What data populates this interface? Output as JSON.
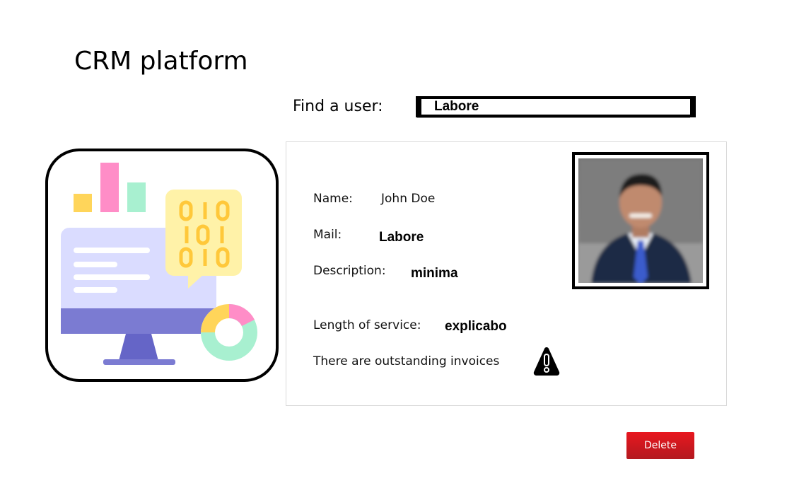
{
  "header": {
    "title": "CRM platform"
  },
  "search": {
    "label": "Find a user:",
    "value": "Labore"
  },
  "user": {
    "name_label": "Name:",
    "name_value": "John Doe",
    "mail_label": "Mail:",
    "mail_value": "Labore",
    "description_label": "Description:",
    "description_value": "minima",
    "service_label": "Length of service:",
    "service_value": "explicabo",
    "invoice_notice": "There are outstanding invoices"
  },
  "actions": {
    "delete_label": "Delete"
  },
  "icons": {
    "warning": "warning-icon",
    "illustration": "crm-dashboard-illustration",
    "photo": "user-photo"
  },
  "colors": {
    "delete_button": "#d0191f",
    "bar_yellow": "#ffd55a",
    "bar_pink": "#ff8dc7",
    "bar_mint": "#a8f0d0",
    "monitor": "#7b7bd2",
    "monitor_screen": "#dadcff"
  }
}
